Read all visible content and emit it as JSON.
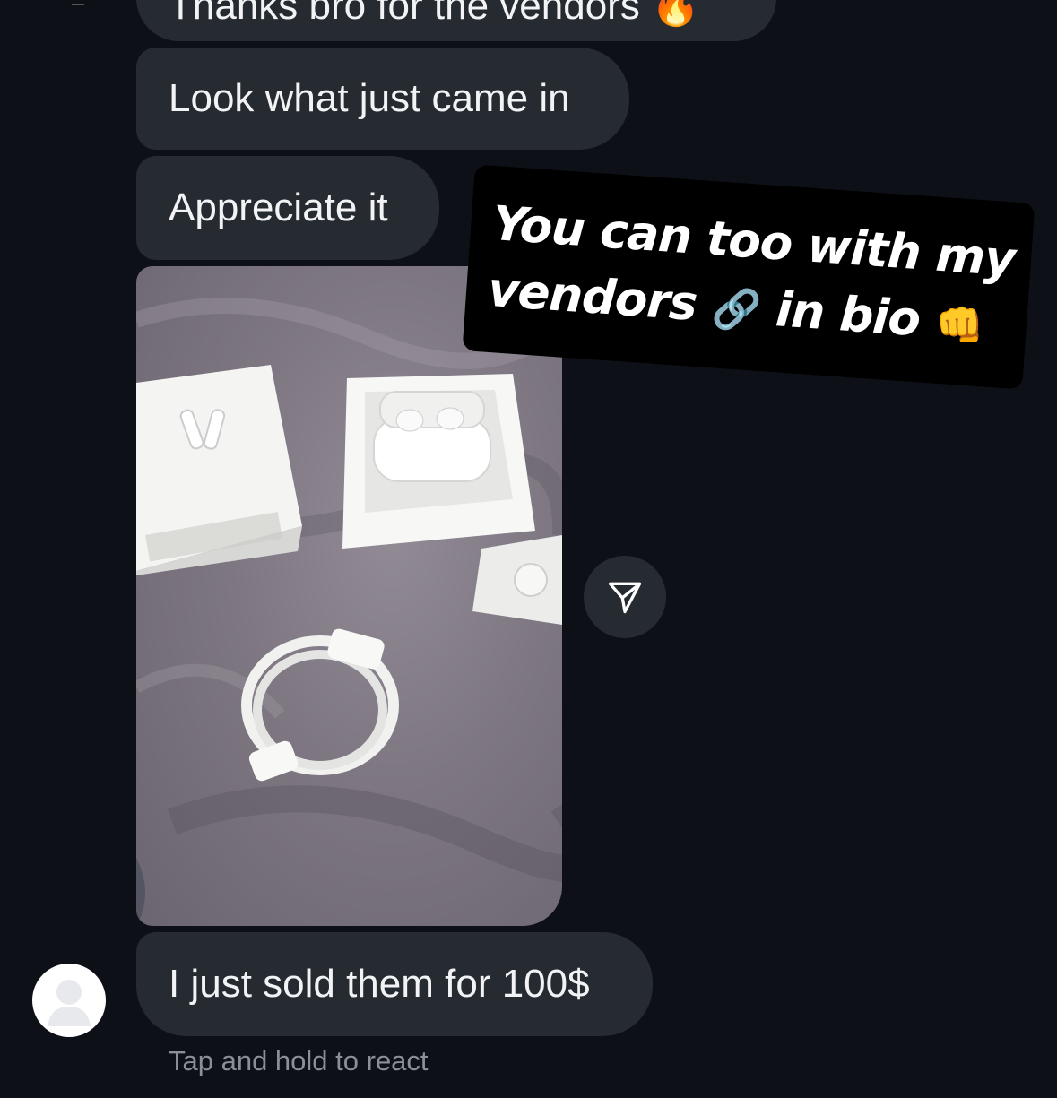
{
  "messages": {
    "partial_top": "Thanks bro for the vendors 🔥",
    "msg1": "Look what just came in",
    "msg2": "Appreciate it",
    "msg3": "I just sold them for 100$"
  },
  "photo": {
    "description_icon": "photo-attachment"
  },
  "share_icon": "send-icon",
  "avatar_icon": "user-silhouette-icon",
  "hint": "Tap and hold to react",
  "overlay": {
    "line1": "You can too with my",
    "line2_word1": "vendors",
    "line2_icon": "🔗",
    "line2_word2": "in bio",
    "line2_emoji": "👊"
  },
  "colors": {
    "background": "#0d1117",
    "bubble": "#262a31",
    "text": "#f2f3f5",
    "hint": "#8b8f96",
    "overlay_bg": "#000000"
  }
}
